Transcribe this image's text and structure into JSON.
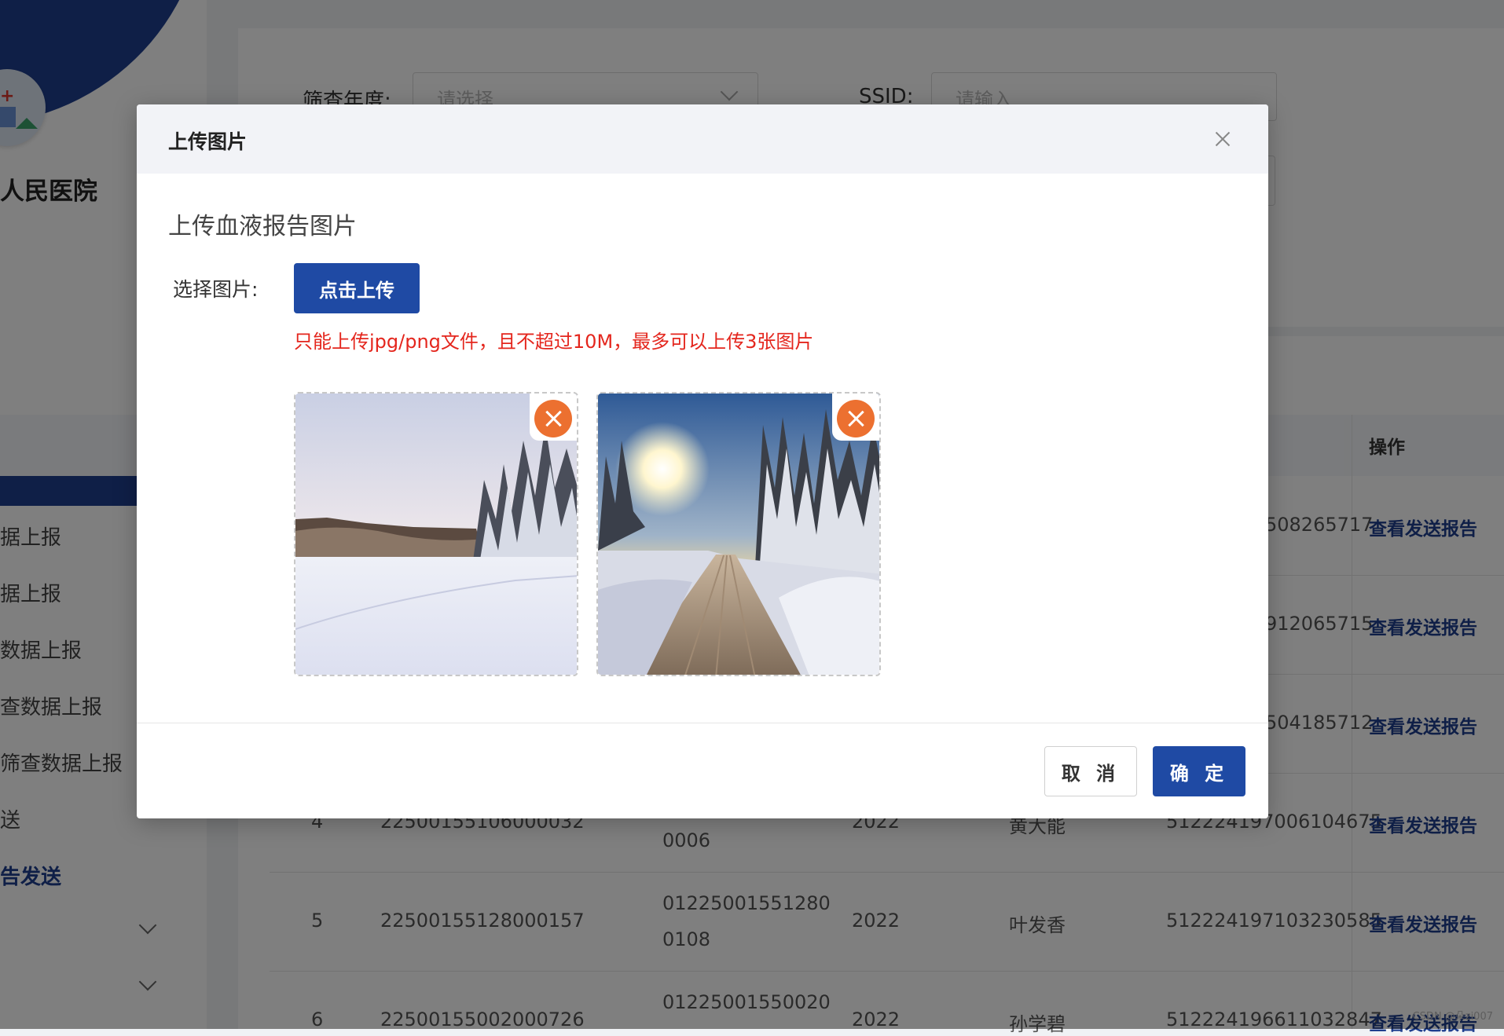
{
  "sidebar": {
    "hospital_name": "人民医院",
    "menu": [
      {
        "label": "据上报"
      },
      {
        "label": "据上报"
      },
      {
        "label": "数据上报"
      },
      {
        "label": "查数据上报"
      },
      {
        "label": "筛查数据上报"
      },
      {
        "label": "送"
      },
      {
        "label": "告发送"
      }
    ]
  },
  "filters": {
    "year_label": "筛查年度:",
    "year_placeholder": "请选择",
    "ssid_label": "SSID:",
    "ssid_placeholder": "请输入"
  },
  "table": {
    "op_header": "操作",
    "rows": [
      {
        "id_fragment": "508265717",
        "action": "查看发送报告"
      },
      {
        "id_fragment": "912065715",
        "action": "查看发送报告"
      },
      {
        "id_fragment": "504185712",
        "action": "查看发送报告"
      },
      {
        "index": "4",
        "code": "22500155106000032",
        "barcode_l1": "",
        "barcode_l2": "0006",
        "year": "2022",
        "name": "黄大能",
        "id_card": "512224197006104675",
        "action": "查看发送报告"
      },
      {
        "index": "5",
        "code": "22500155128000157",
        "barcode_l1": "01225001551280",
        "barcode_l2": "0108",
        "year": "2022",
        "name": "叶发香",
        "id_card": "512224197103230585",
        "action": "查看发送报告"
      },
      {
        "index": "6",
        "code": "22500155002000726",
        "barcode_l1": "01225001550020",
        "barcode_l2": "",
        "year": "2022",
        "name": "孙学碧",
        "id_card": "512224196611032847",
        "action": "查看发送报告"
      }
    ]
  },
  "watermark": "CSDN @朵zi007",
  "dialog": {
    "title": "上传图片",
    "section_title": "上传血液报告图片",
    "field_label": "选择图片:",
    "upload_button": "点击上传",
    "tip": "只能上传jpg/png文件，且不超过10M，最多可以上传3张图片",
    "cancel_button": "取 消",
    "confirm_button": "确 定"
  },
  "colors": {
    "primary": "#1f4aa4",
    "sidebar_brand": "#1f3f8f",
    "tip_red": "#e4261d",
    "remove_orange": "#ec7030"
  }
}
